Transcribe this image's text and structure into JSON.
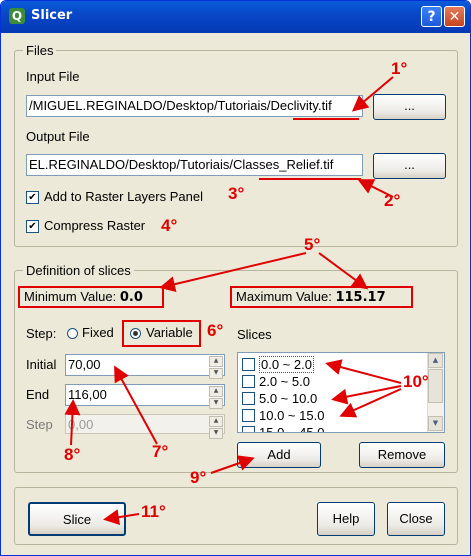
{
  "window": {
    "title": "Slicer",
    "app_icon": "Q",
    "help_label": "?",
    "close_label": "✕"
  },
  "files": {
    "group_title": "Files",
    "input_label": "Input File",
    "input_value": "/MIGUEL.REGINALDO/Desktop/Tutoriais/Declivity.tif",
    "output_label": "Output File",
    "output_value": "EL.REGINALDO/Desktop/Tutoriais/Classes_Relief.tif",
    "browse_label": "...",
    "add_to_panel": {
      "label": "Add to Raster Layers Panel",
      "checked": true
    },
    "compress": {
      "label": "Compress Raster",
      "checked": true
    }
  },
  "slices": {
    "group_title": "Definition of slices",
    "min_label": "Minimum Value:",
    "min_value": "0.0",
    "max_label": "Maximum Value:",
    "max_value": "115.17",
    "step_label": "Step:",
    "fixed_label": "Fixed",
    "variable_label": "Variable",
    "selected_mode": "Variable",
    "initial_label": "Initial",
    "initial_value": "70,00",
    "end_label": "End",
    "end_value": "116,00",
    "step_field_label": "Step",
    "step_value": "0,00",
    "list_label": "Slices",
    "items": [
      "0.0 ~ 2.0",
      "2.0 ~ 5.0",
      "5.0 ~ 10.0",
      "10.0 ~ 15.0",
      "15.0 ~ 45.0"
    ],
    "add_label": "Add",
    "remove_label": "Remove"
  },
  "footer": {
    "slice_label": "Slice",
    "help_label": "Help",
    "close_label": "Close"
  },
  "annotations": [
    "1°",
    "2°",
    "3°",
    "4°",
    "5°",
    "6°",
    "7°",
    "8°",
    "9°",
    "10°",
    "11°"
  ],
  "colors": {
    "annotation": "#E00000",
    "titlebar": "#0846C6",
    "dialog": "#ECE9D8"
  }
}
